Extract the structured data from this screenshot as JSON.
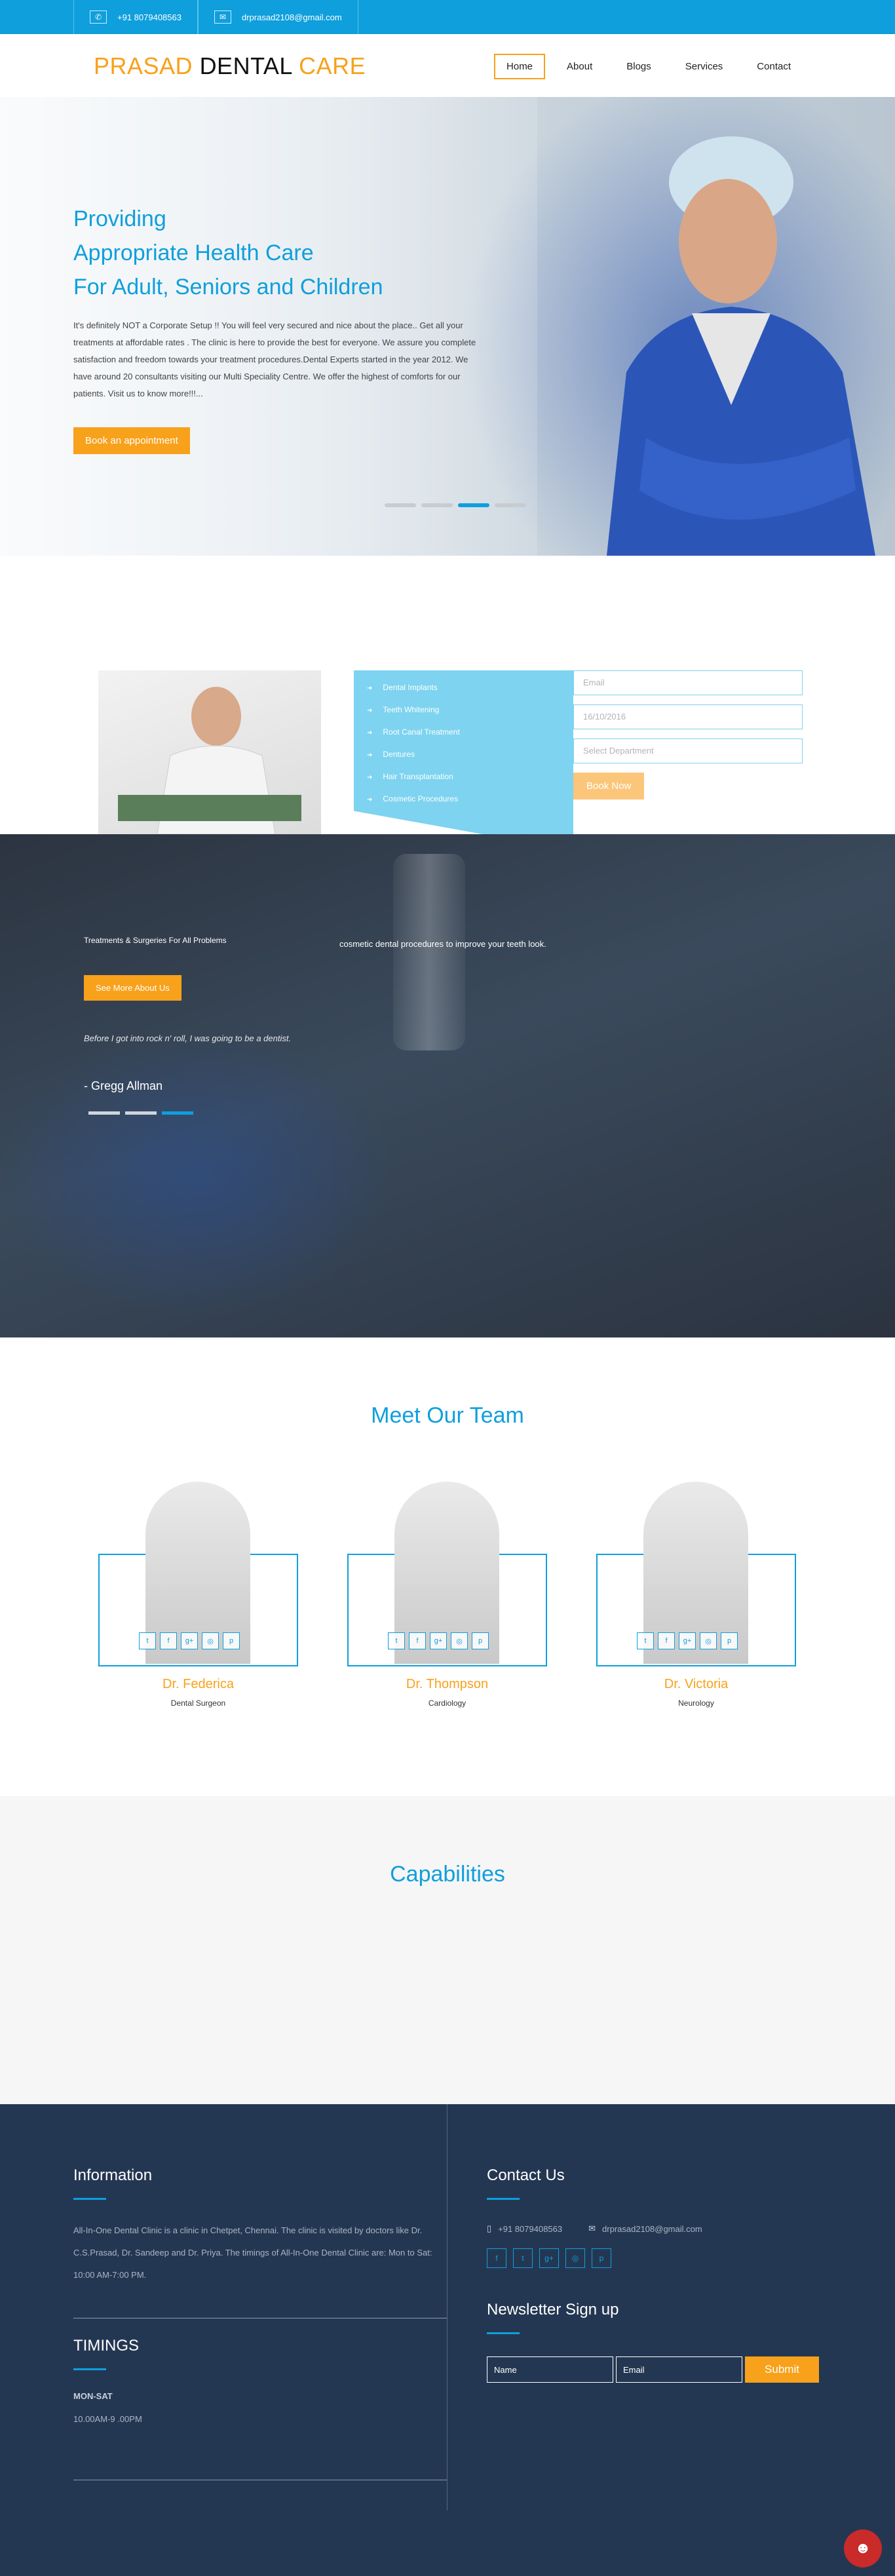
{
  "topbar": {
    "phone": "+91 8079408563",
    "email": "drprasad2108@gmail.com"
  },
  "header": {
    "logo": {
      "part1": "PRASAD",
      "part2": "DENTAL",
      "part3": "CARE"
    },
    "nav": [
      "Home",
      "About",
      "Blogs",
      "Services",
      "Contact"
    ]
  },
  "hero": {
    "line1": "Providing",
    "line2": "Appropriate Health Care",
    "line3": "For Adult, Seniors and Children",
    "body": "It's definitely NOT a Corporate Setup !! You will feel very secured and nice about the place.. Get all your treatments at affordable rates . The clinic is here to provide the best for everyone. We assure you complete satisfaction and freedom towards your treatment procedures.Dental Experts started in the year 2012. We have around 20 consultants visiting our Multi Speciality Centre. We offer the highest of comforts for our patients. Visit us to know more!!!...",
    "cta": "Book an appointment",
    "slides": 4,
    "active_slide": 3
  },
  "appointment": {
    "services": [
      "Dental Implants",
      "Teeth Whitening",
      "Root Canal Treatment",
      "Dentures",
      "Hair Transplantation",
      "Cosmetic Procedures"
    ],
    "email_placeholder": "Email",
    "date_value": "16/10/2016",
    "department_placeholder": "Select Department",
    "submit": "Book Now"
  },
  "testimonial": {
    "left_text": "Treatments & Surgeries For All Problems",
    "right_text": "cosmetic dental procedures to improve your teeth look.",
    "cta": "See More About Us",
    "quote": "Before I got into rock n' roll, I was going to be a dentist.",
    "author": "- Gregg Allman",
    "slides": 3,
    "active_slide": 3
  },
  "team": {
    "title": "Meet Our Team",
    "members": [
      {
        "name": "Dr. Federica",
        "role": "Dental Surgeon"
      },
      {
        "name": "Dr. Thompson",
        "role": "Cardiology"
      },
      {
        "name": "Dr. Victoria",
        "role": "Neurology"
      }
    ],
    "socials": [
      "twitter-icon",
      "facebook-icon",
      "google-plus-icon",
      "dribbble-icon",
      "pinterest-icon"
    ]
  },
  "capabilities": {
    "title": "Capabilities"
  },
  "footer": {
    "info_title": "Information",
    "info_text": "All-In-One Dental Clinic is a clinic in Chetpet, Chennai. The clinic is visited by doctors like Dr. C.S.Prasad, Dr. Sandeep and Dr. Priya. The timings of All-In-One Dental Clinic are: Mon to Sat: 10:00 AM-7:00 PM.",
    "timings_title": "TIMINGS",
    "days": "MON-SAT",
    "hours": "10.00AM-9 .00PM",
    "contact_title": "Contact Us",
    "phone": "+91 8079408563",
    "email": "drprasad2108@gmail.com",
    "newsletter_title": "Newsletter Sign up",
    "name_placeholder": "Name",
    "email_placeholder": "Email",
    "submit": "Submit"
  },
  "colors": {
    "accent": "#0f9fdc",
    "brand": "#f8a11b",
    "footer": "#243752"
  }
}
